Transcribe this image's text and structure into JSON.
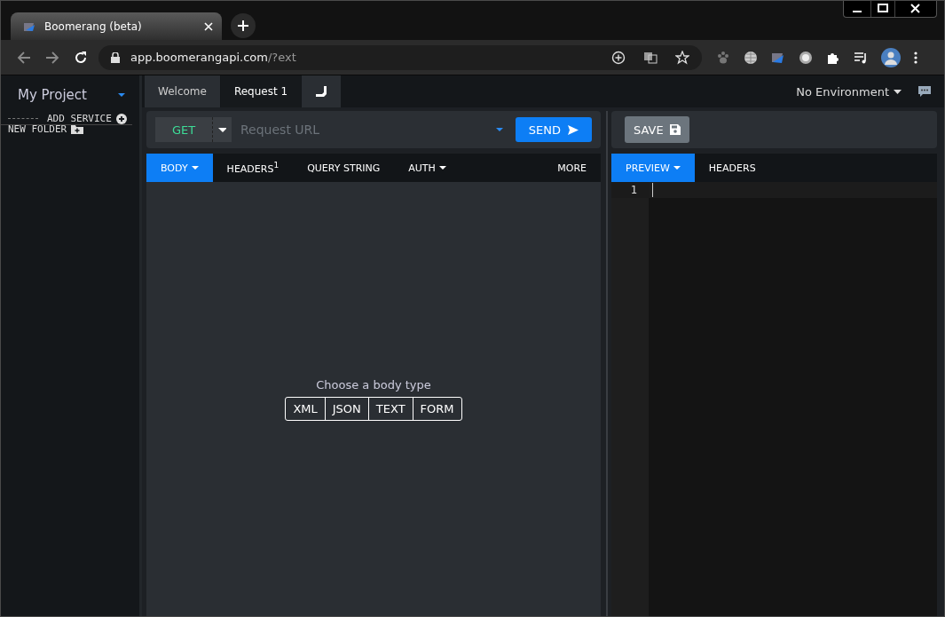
{
  "browser": {
    "tab_title": "Boomerang (beta)",
    "url_host": "app.boomerangapi.com",
    "url_rest": "/?ext"
  },
  "sidebar": {
    "project": "My Project",
    "actions": [
      {
        "kind": "service",
        "label": "ADD SERVICE"
      },
      {
        "kind": "folder",
        "label": "NEW FOLDER"
      }
    ]
  },
  "tabs": [
    {
      "kind": "text",
      "label": "Welcome",
      "selected": false
    },
    {
      "kind": "text",
      "label": "Request 1",
      "selected": true
    },
    {
      "kind": "icon",
      "selected": false
    }
  ],
  "environment": "No Environment",
  "request": {
    "method": "GET",
    "url_placeholder": "Request URL",
    "send": "SEND",
    "tabs": [
      {
        "label": "BODY",
        "selected": true,
        "dropdown": true
      },
      {
        "label": "HEADERS$^{1}$",
        "selected": false,
        "dropdown": false
      },
      {
        "label": "QUERY STRING",
        "selected": false,
        "dropdown": false
      },
      {
        "label": "AUTH",
        "selected": false,
        "dropdown": true
      },
      {
        "label": "MORE",
        "selected": false,
        "dropdown": false
      }
    ],
    "body_prompt": "Choose a body type",
    "body_types": [
      "XML",
      "JSON",
      "TEXT",
      "FORM"
    ]
  },
  "response": {
    "save": "SAVE",
    "tabs": [
      {
        "label": "PREVIEW",
        "selected": true,
        "dropdown": true
      },
      {
        "label": "HEADERS",
        "selected": false,
        "dropdown": false
      }
    ],
    "line_numbers": [
      "1"
    ]
  }
}
